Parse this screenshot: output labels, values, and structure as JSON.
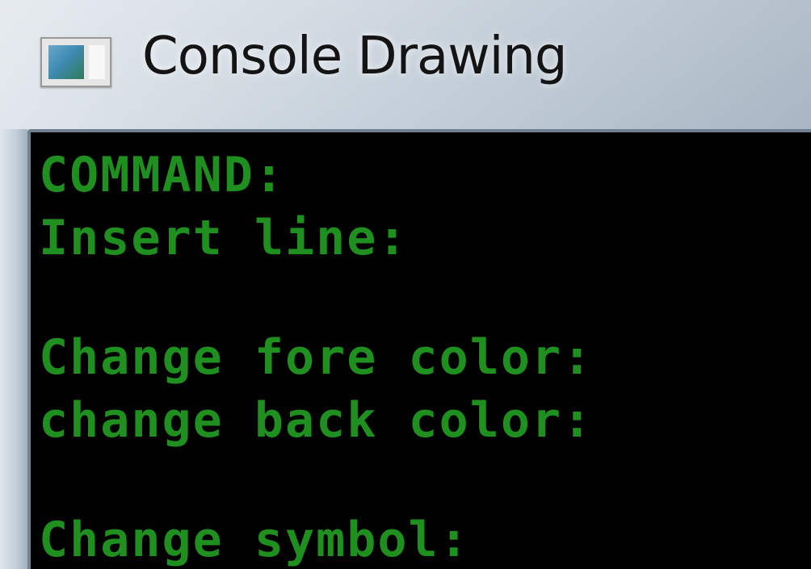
{
  "window": {
    "title": "Console Drawing",
    "icon": "console-app-icon"
  },
  "console": {
    "text_color": "#1f8f1f",
    "background_color": "#000000",
    "lines": [
      "COMMAND:",
      "Insert line:",
      "",
      "Change fore color:",
      "change back color:",
      "",
      "Change symbol:"
    ]
  }
}
